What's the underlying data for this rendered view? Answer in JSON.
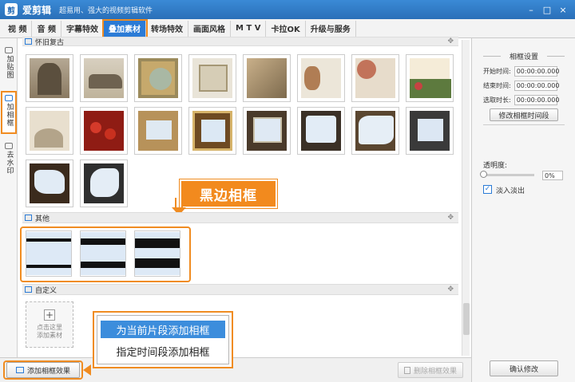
{
  "window": {
    "app_name": "爱剪辑",
    "slogan": "超易用、强大的视频剪辑软件",
    "minimize": "–",
    "maximize": "□",
    "close": "×"
  },
  "tabs": [
    {
      "label": "视 频"
    },
    {
      "label": "音 频"
    },
    {
      "label": "字幕特效"
    },
    {
      "label": "叠加素材",
      "active": true
    },
    {
      "label": "转场特效"
    },
    {
      "label": "画面风格"
    },
    {
      "label": "M T V"
    },
    {
      "label": "卡拉OK"
    },
    {
      "label": "升级与服务"
    }
  ],
  "left_tabs": [
    {
      "label": "加贴图"
    },
    {
      "label": "加相框",
      "active": true
    },
    {
      "label": "去水印"
    }
  ],
  "sections": {
    "top_partial": {
      "title": "怀旧复古"
    },
    "other": {
      "title": "其他"
    },
    "custom": {
      "title": "自定义"
    }
  },
  "custom_add": {
    "plus": "+",
    "line1": "点击这里",
    "line2": "添加素材"
  },
  "callout": {
    "text": "黑边相框"
  },
  "context_menu": {
    "item1": "为当前片段添加相框",
    "item2": "指定时间段添加相框"
  },
  "bottom": {
    "add_button": "添加相框效果",
    "delete_button": "删除相框效果"
  },
  "right_panel": {
    "title": "相框设置",
    "start_label": "开始时间:",
    "start_value": "00:00:00.000",
    "end_label": "结束时间:",
    "end_value": "00:00:00.000",
    "duration_label": "选取时长:",
    "duration_value": "00:00:00.000",
    "modify_time_button": "修改相框时间段",
    "opacity_label": "透明度:",
    "opacity_value": "0%",
    "opacity_fraction": 0,
    "fade_checked": true,
    "fade_label": "淡入淡出",
    "confirm_button": "确认修改"
  },
  "colors": {
    "accent": "#2b7bd6",
    "highlight": "#f08c21"
  }
}
